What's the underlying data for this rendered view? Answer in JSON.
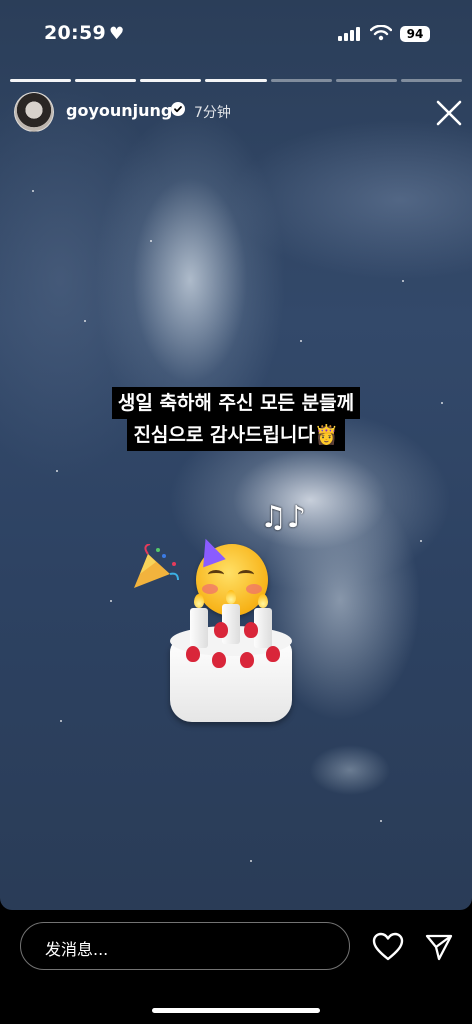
{
  "status_bar": {
    "time": "20:59",
    "battery": "94"
  },
  "story": {
    "progress": {
      "segments": 7,
      "completed": 4
    },
    "username": "goyounjung",
    "verified": true,
    "time_ago": "7分钟",
    "caption_lines": [
      "생일 축하해 주신 모든 분들께",
      "진심으로 감사드립니다👸"
    ]
  },
  "reply": {
    "placeholder": "发消息..."
  },
  "icons": {
    "status_heart": "heart-icon",
    "signal": "signal-icon",
    "wifi": "wifi-icon",
    "verified": "verified-badge-icon",
    "close": "close-icon",
    "like": "heart-outline-icon",
    "send": "paper-plane-icon"
  }
}
